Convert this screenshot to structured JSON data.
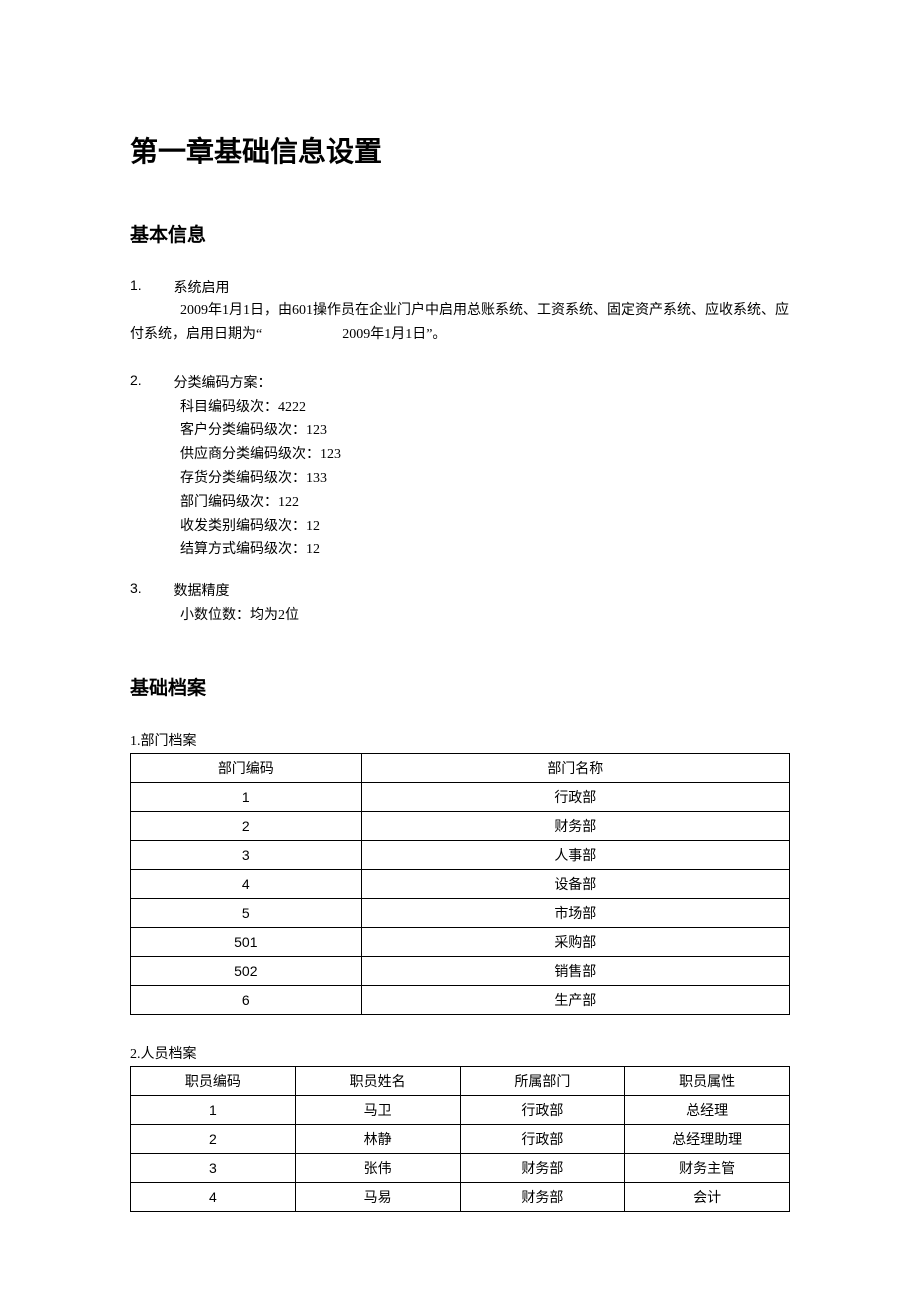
{
  "chapter_title": "第一章基础信息设置",
  "section1": {
    "title": "基本信息",
    "item1": {
      "num": "1.",
      "label": "系统启用",
      "text_pre": "2009年1月1日，由601操作员在企业门户中启用总账系统、工资系统、固定资产系统、应收系统、应付系统，启用日期为“",
      "text_mid": "2009年1月1日”。"
    },
    "item2": {
      "num": "2.",
      "label": "分类编码方案：",
      "lines": [
        "科目编码级次：4222",
        "客户分类编码级次：123",
        "供应商分类编码级次：123",
        "存货分类编码级次：133",
        "部门编码级次：122",
        "收发类别编码级次：12",
        "结算方式编码级次：12"
      ]
    },
    "item3": {
      "num": "3.",
      "label": "数据精度",
      "text": "小数位数：均为2位"
    }
  },
  "section2": {
    "title": "基础档案",
    "table1": {
      "title": "1.部门档案",
      "headers": [
        "部门编码",
        "部门名称"
      ],
      "rows": [
        [
          "1",
          "行政部"
        ],
        [
          "2",
          "财务部"
        ],
        [
          "3",
          "人事部"
        ],
        [
          "4",
          "设备部"
        ],
        [
          "5",
          "市场部"
        ],
        [
          "501",
          "采购部"
        ],
        [
          "502",
          "销售部"
        ],
        [
          "6",
          "生产部"
        ]
      ]
    },
    "table2": {
      "title": "2.人员档案",
      "headers": [
        "职员编码",
        "职员姓名",
        "所属部门",
        "职员属性"
      ],
      "rows": [
        [
          "1",
          "马卫",
          "行政部",
          "总经理"
        ],
        [
          "2",
          "林静",
          "行政部",
          "总经理助理"
        ],
        [
          "3",
          "张伟",
          "财务部",
          "财务主管"
        ],
        [
          "4",
          "马易",
          "财务部",
          "会计"
        ]
      ]
    }
  }
}
